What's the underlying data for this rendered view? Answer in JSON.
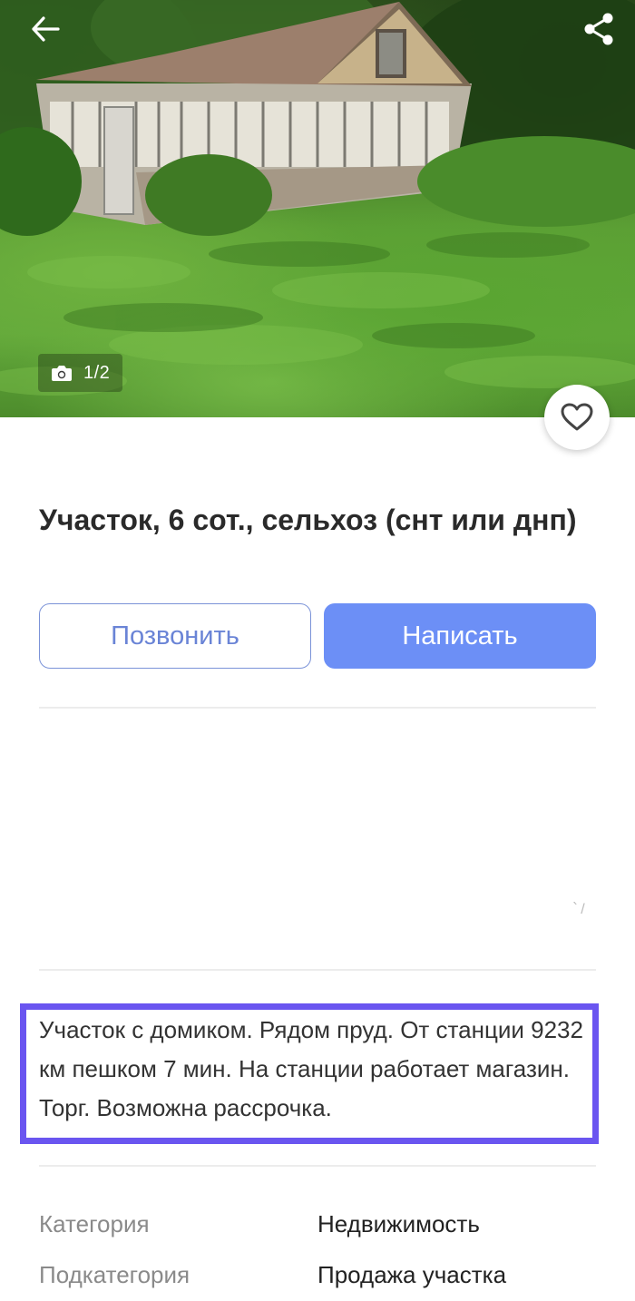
{
  "photo": {
    "counter": "1/2",
    "icons": {
      "back": "arrow-left-icon",
      "share": "share-icon",
      "camera": "camera-icon",
      "favorite": "heart-outline-icon"
    }
  },
  "listing": {
    "title": "Участок, 6 сот., сельхоз (снт или днп)",
    "description": "Участок с домиком. Рядом пруд. От станции 9232 км пешком 7 мин. На станции работает магазин. Торг. Возможна рассрочка."
  },
  "actions": {
    "call_label": "Позвонить",
    "write_label": "Написать"
  },
  "misc": {
    "faint_glyph": "՝ /"
  },
  "properties": [
    {
      "key": "Категория",
      "value": "Недвижимость"
    },
    {
      "key": "Подкатегория",
      "value": "Продажа участка"
    }
  ],
  "colors": {
    "accent": "#6c8ff6",
    "outline_button": "#7b93d8",
    "highlight_border": "#6a55f0"
  }
}
